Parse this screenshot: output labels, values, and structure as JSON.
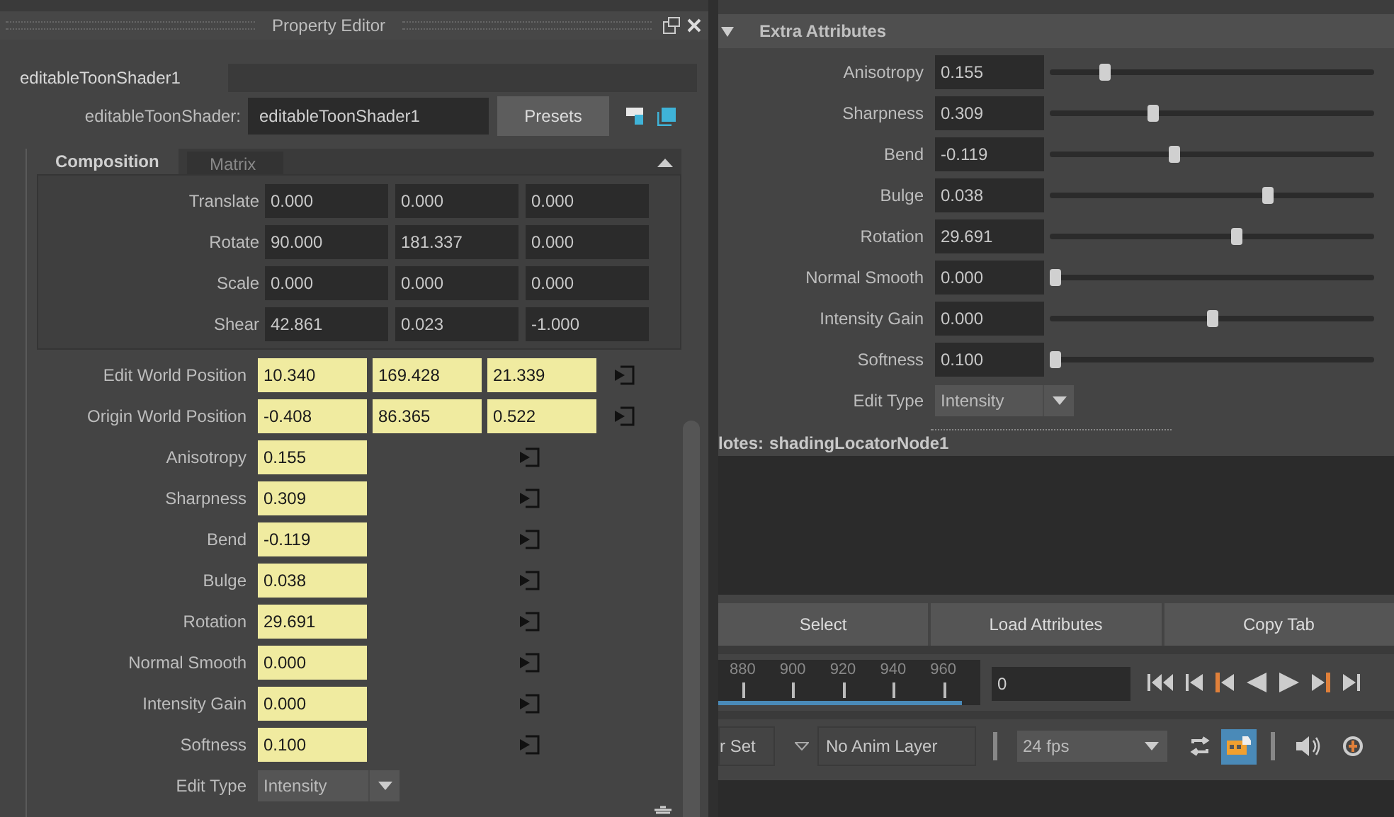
{
  "property_editor": {
    "title": "Property Editor",
    "tabs": [
      {
        "label": "editableToonShader1",
        "selected": true
      }
    ],
    "node_label": "editableToonShader:",
    "node_name": "editableToonShader1",
    "presets_button": "Presets",
    "section_tabs": [
      {
        "label": "Composition",
        "selected": true
      },
      {
        "label": "Matrix",
        "selected": false
      }
    ],
    "composition_rows": [
      {
        "label": "Translate",
        "values": [
          "0.000",
          "0.000",
          "0.000"
        ],
        "keyed": false
      },
      {
        "label": "Rotate",
        "values": [
          "90.000",
          "181.337",
          "0.000"
        ],
        "keyed": false
      },
      {
        "label": "Scale",
        "values": [
          "0.000",
          "0.000",
          "0.000"
        ],
        "keyed": false
      },
      {
        "label": "Shear",
        "values": [
          "42.861",
          "0.023",
          "-1.000"
        ],
        "keyed": false
      }
    ],
    "attribute_rows": [
      {
        "kind": "vector",
        "label": "Edit World Position",
        "values": [
          "10.340",
          "169.428",
          "21.339"
        ],
        "keyed": true
      },
      {
        "kind": "vector",
        "label": "Origin World Position",
        "values": [
          "-0.408",
          "86.365",
          "0.522"
        ],
        "keyed": true
      },
      {
        "kind": "scalar",
        "label": "Anisotropy",
        "values": [
          "0.155"
        ],
        "keyed": true
      },
      {
        "kind": "scalar",
        "label": "Sharpness",
        "values": [
          "0.309"
        ],
        "keyed": true
      },
      {
        "kind": "scalar",
        "label": "Bend",
        "values": [
          "-0.119"
        ],
        "keyed": true
      },
      {
        "kind": "scalar",
        "label": "Bulge",
        "values": [
          "0.038"
        ],
        "keyed": true
      },
      {
        "kind": "scalar",
        "label": "Rotation",
        "values": [
          "29.691"
        ],
        "keyed": true
      },
      {
        "kind": "scalar",
        "label": "Normal Smooth",
        "values": [
          "0.000"
        ],
        "keyed": true
      },
      {
        "kind": "scalar",
        "label": "Intensity Gain",
        "values": [
          "0.000"
        ],
        "keyed": true
      },
      {
        "kind": "scalar",
        "label": "Softness",
        "values": [
          "0.100"
        ],
        "keyed": true
      },
      {
        "kind": "enum",
        "label": "Edit Type",
        "value": "Intensity"
      }
    ]
  },
  "extra_attributes": {
    "title": "Extra Attributes",
    "expanded": true,
    "rows": [
      {
        "kind": "slider",
        "label": "Anisotropy",
        "value": "0.155",
        "level": 0.16
      },
      {
        "kind": "slider",
        "label": "Sharpness",
        "value": "0.309",
        "level": 0.31
      },
      {
        "kind": "slider",
        "label": "Bend",
        "value": "-0.119",
        "level": 0.38
      },
      {
        "kind": "slider",
        "label": "Bulge",
        "value": "0.038",
        "level": 0.68
      },
      {
        "kind": "slider",
        "label": "Rotation",
        "value": "29.691",
        "level": 0.58
      },
      {
        "kind": "slider",
        "label": "Normal Smooth",
        "value": "0.000",
        "level": 0
      },
      {
        "kind": "slider",
        "label": "Intensity Gain",
        "value": "0.000",
        "level": 0.5
      },
      {
        "kind": "slider",
        "label": "Softness",
        "value": "0.100",
        "level": 0
      },
      {
        "kind": "enum",
        "label": "Edit Type",
        "value": "Intensity"
      }
    ]
  },
  "notes": {
    "label": "lotes:",
    "node": "shadingLocatorNode1"
  },
  "buttons": [
    "Select",
    "Load Attributes",
    "Copy Tab"
  ],
  "time_slider": {
    "ticks": [
      "880",
      "900",
      "920",
      "940",
      "960"
    ],
    "level": 0.93,
    "current_frame": "0"
  },
  "playback_options": {
    "character_set": "r Set",
    "anim_layer": "No Anim Layer",
    "fps": "24 fps",
    "cached_playback": {
      "selected": true
    }
  }
}
